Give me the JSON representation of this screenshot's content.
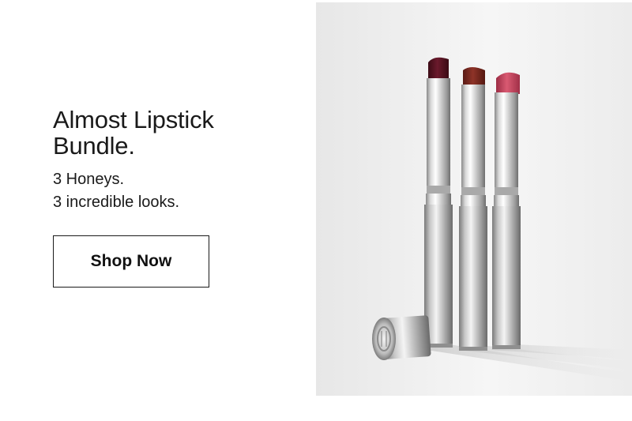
{
  "promo": {
    "headline_line1": "Almost Lipstick",
    "headline_line2": "Bundle.",
    "subline1": "3 Honeys.",
    "subline2": "3 incredible looks.",
    "cta_label": "Shop Now"
  },
  "image": {
    "subject": "three-lipsticks-with-cap",
    "shades": [
      "#5e1626",
      "#7c2a22",
      "#c2415a"
    ]
  }
}
